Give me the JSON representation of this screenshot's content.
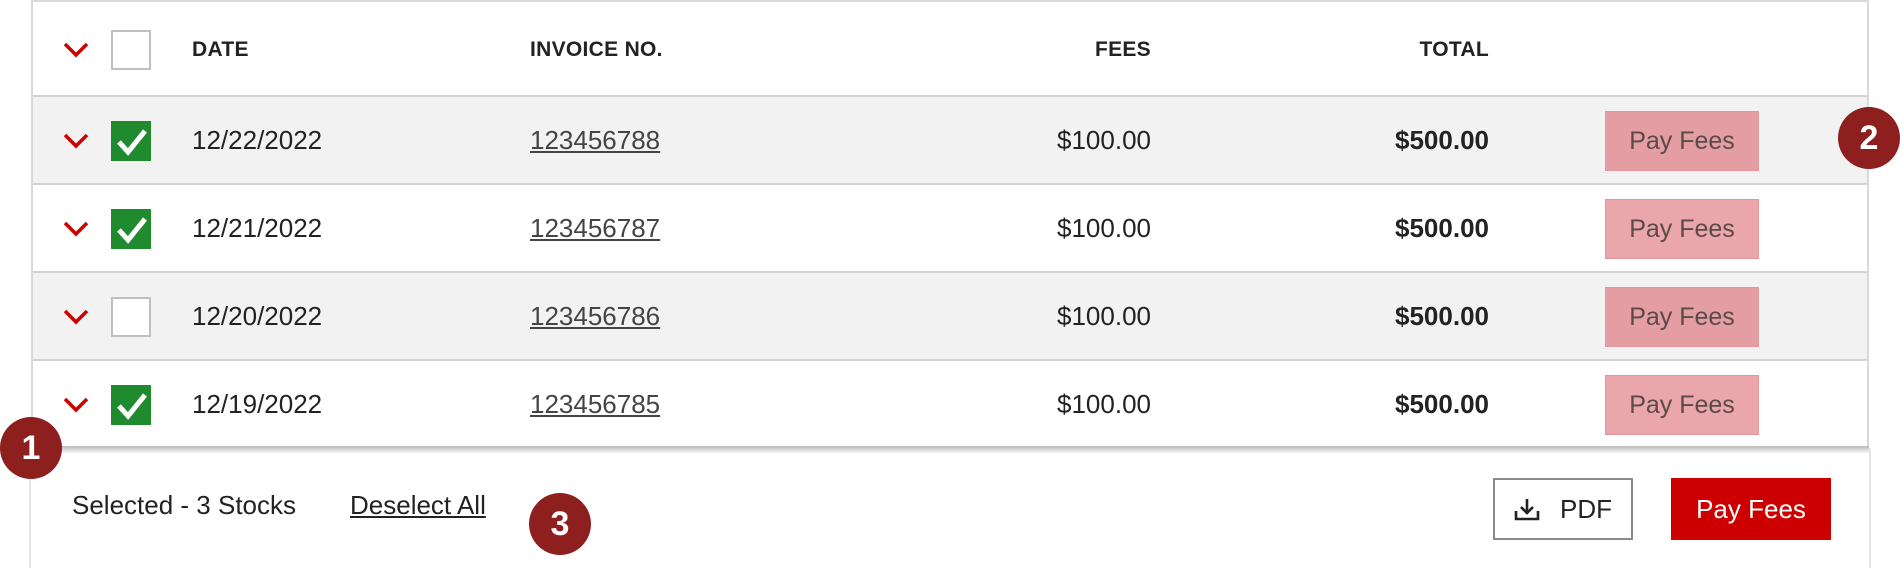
{
  "table": {
    "headers": {
      "date": "DATE",
      "invoice": "INVOICE NO.",
      "fees": "FEES",
      "total": "TOTAL"
    },
    "rows": [
      {
        "date": "12/22/2022",
        "invoice": "123456788",
        "fees": "$100.00",
        "total": "$500.00",
        "action": "Pay Fees",
        "checked": true
      },
      {
        "date": "12/21/2022",
        "invoice": "123456787",
        "fees": "$100.00",
        "total": "$500.00",
        "action": "Pay Fees",
        "checked": true
      },
      {
        "date": "12/20/2022",
        "invoice": "123456786",
        "fees": "$100.00",
        "total": "$500.00",
        "action": "Pay Fees",
        "checked": false
      },
      {
        "date": "12/19/2022",
        "invoice": "123456785",
        "fees": "$100.00",
        "total": "$500.00",
        "action": "Pay Fees",
        "checked": true
      }
    ]
  },
  "footer": {
    "selected_text": "Selected - 3 Stocks",
    "deselect_label": "Deselect All",
    "pdf_label": "PDF",
    "pay_label": "Pay Fees"
  },
  "badges": [
    "1",
    "2",
    "3"
  ],
  "icons": {
    "expand": "chevron-down-icon",
    "check": "checkmark-icon",
    "download": "download-icon"
  },
  "colors": {
    "accent_red": "#cc0000",
    "checkbox_green": "#1f8a2e",
    "pay_disabled": "#eaa6aa",
    "badge": "#8d1f1f"
  }
}
